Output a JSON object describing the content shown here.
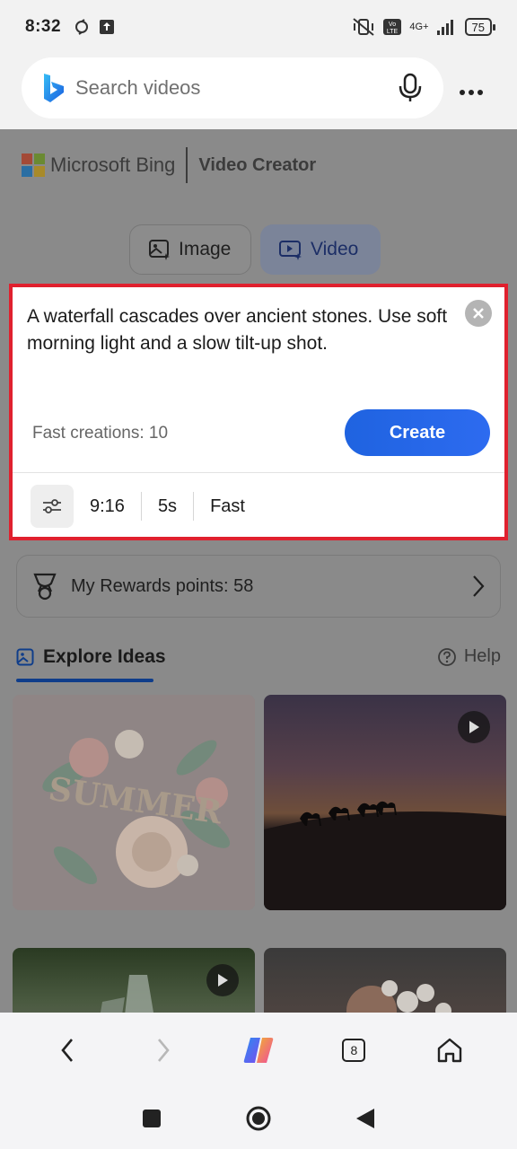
{
  "status_bar": {
    "time": "8:32",
    "battery": "75",
    "network": "4G+"
  },
  "search": {
    "placeholder": "Search videos"
  },
  "brand": {
    "microsoft_bing": "Microsoft Bing",
    "product": "Video Creator"
  },
  "mode_tabs": [
    {
      "label": "Image",
      "selected": false
    },
    {
      "label": "Video",
      "selected": true
    }
  ],
  "prompt": {
    "text": "A waterfall cascades over ancient stones. Use soft morning light and a slow tilt-up shot.",
    "fast_creations": "Fast creations: 10",
    "create_label": "Create"
  },
  "settings": {
    "aspect_ratio": "9:16",
    "duration": "5s",
    "speed": "Fast"
  },
  "rewards": {
    "label": "My Rewards points: 58"
  },
  "explore": {
    "title": "Explore Ideas",
    "help": "Help"
  },
  "bottom_nav": {
    "tab_count": "8"
  },
  "colors": {
    "accent": "#1f63e0",
    "highlight_border": "#e0202e"
  }
}
